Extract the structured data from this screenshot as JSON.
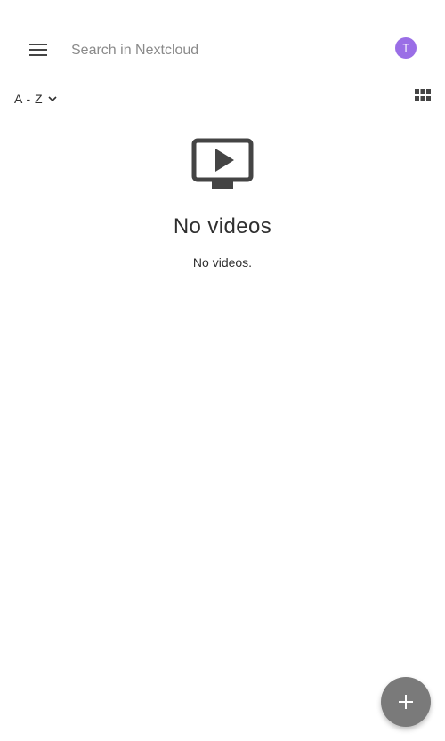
{
  "search": {
    "placeholder": "Search in Nextcloud"
  },
  "avatar": {
    "initial": "T",
    "color": "#9a6ee6"
  },
  "sort": {
    "label": "A - Z"
  },
  "empty_state": {
    "title": "No videos",
    "message": "No videos."
  },
  "icons": {
    "menu": "menu-icon",
    "chevron": "chevron-down-icon",
    "grid": "grid-view-icon",
    "video": "video-icon",
    "add": "plus-icon"
  },
  "colors": {
    "text": "#2f2f2f",
    "placeholder": "#8a8a8a",
    "icon": "#444444",
    "fab": "#7a7a7a"
  }
}
